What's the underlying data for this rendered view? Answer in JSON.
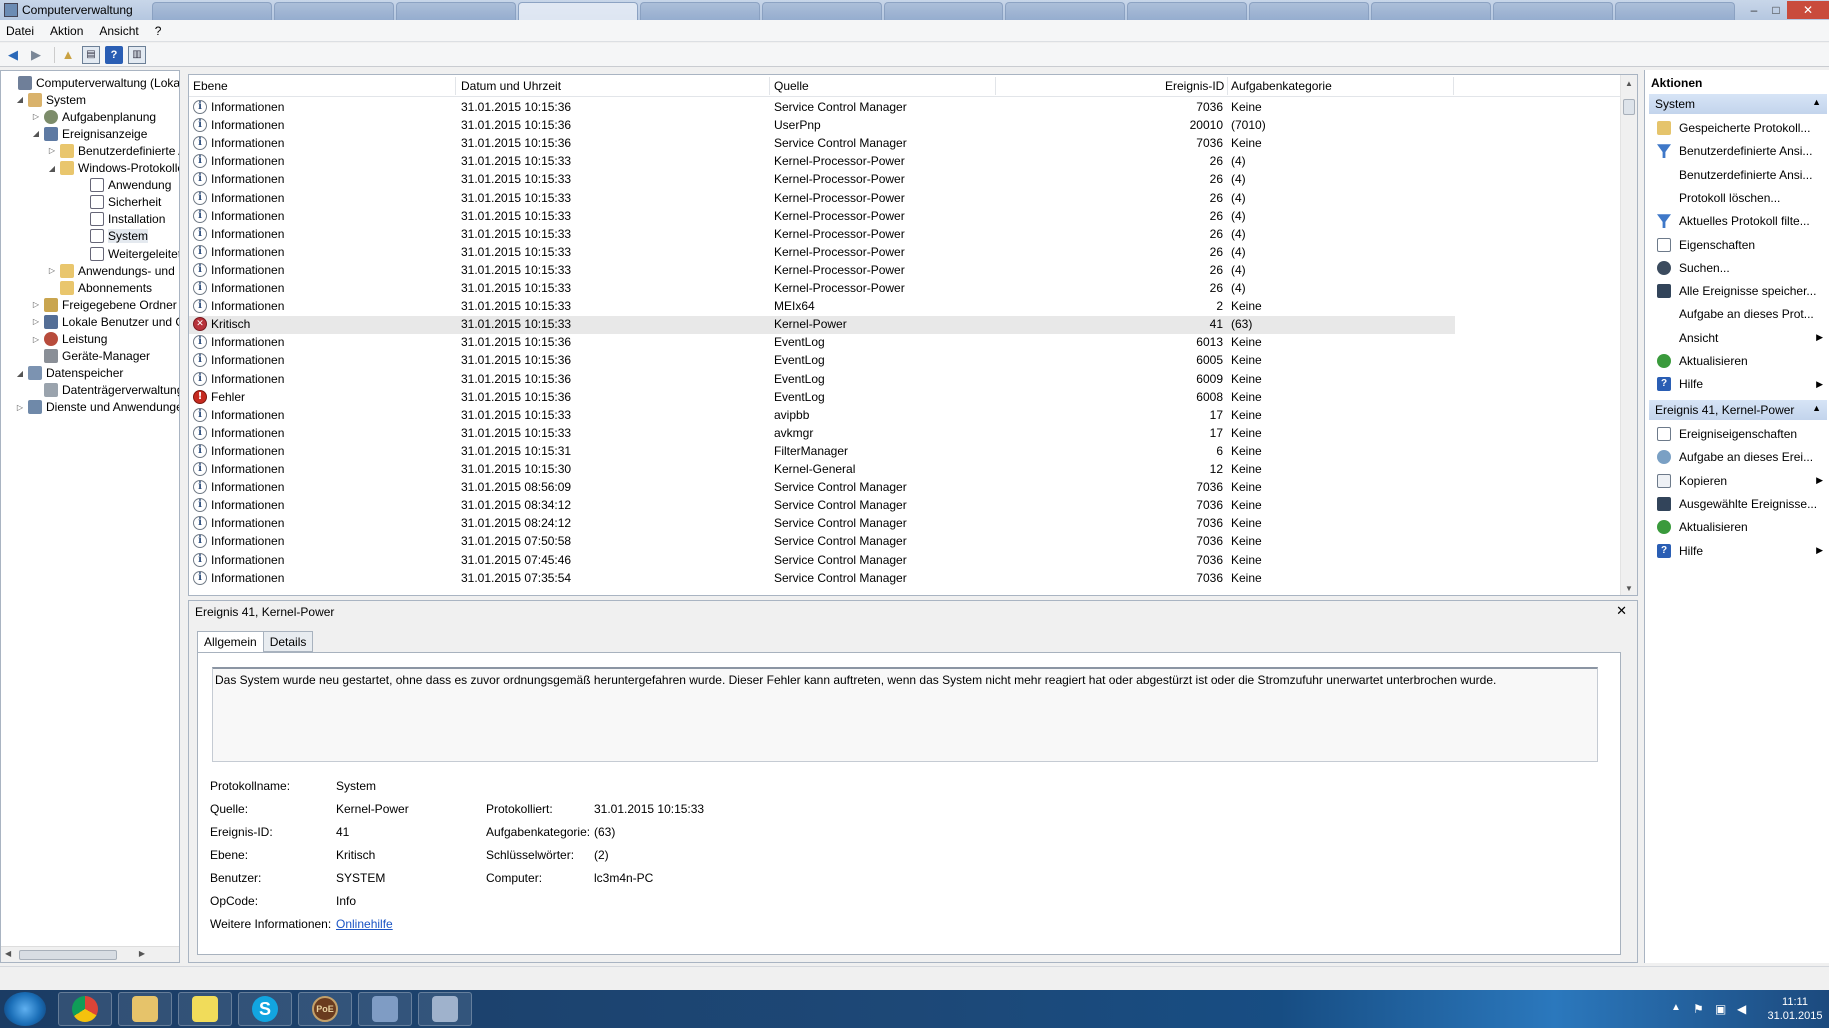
{
  "window": {
    "title": "Computerverwaltung",
    "background_tabs": [
      "",
      "",
      "",
      "",
      "",
      "",
      "",
      "",
      "",
      "",
      "",
      "",
      ""
    ],
    "controls": {
      "minimize": "–",
      "maximize": "□",
      "close": "✕"
    }
  },
  "menu": [
    "Datei",
    "Aktion",
    "Ansicht",
    "?"
  ],
  "tree": [
    {
      "label": "Computerverwaltung (Lokal)",
      "exp": "",
      "icon": "computer-management-icon"
    },
    {
      "label": "System",
      "exp": "◢",
      "icon": "system-tools-icon"
    },
    {
      "label": "Aufgabenplanung",
      "exp": "▷",
      "icon": "task-scheduler-icon"
    },
    {
      "label": "Ereignisanzeige",
      "exp": "◢",
      "icon": "event-viewer-icon"
    },
    {
      "label": "Benutzerdefinierte A",
      "exp": "▷",
      "icon": "folder-icon"
    },
    {
      "label": "Windows-Protokolle",
      "exp": "◢",
      "icon": "folder-icon"
    },
    {
      "label": "Anwendung",
      "exp": "",
      "icon": "log-icon"
    },
    {
      "label": "Sicherheit",
      "exp": "",
      "icon": "log-icon"
    },
    {
      "label": "Installation",
      "exp": "",
      "icon": "log-icon"
    },
    {
      "label": "System",
      "exp": "",
      "icon": "log-icon"
    },
    {
      "label": "Weitergeleitete E",
      "exp": "",
      "icon": "log-icon"
    },
    {
      "label": "Anwendungs- und D",
      "exp": "▷",
      "icon": "folder-icon"
    },
    {
      "label": "Abonnements",
      "exp": "",
      "icon": "subscriptions-icon"
    },
    {
      "label": "Freigegebene Ordner",
      "exp": "▷",
      "icon": "shared-folders-icon"
    },
    {
      "label": "Lokale Benutzer und Gr",
      "exp": "▷",
      "icon": "users-icon"
    },
    {
      "label": "Leistung",
      "exp": "▷",
      "icon": "performance-icon"
    },
    {
      "label": "Geräte-Manager",
      "exp": "",
      "icon": "device-manager-icon"
    },
    {
      "label": "Datenspeicher",
      "exp": "◢",
      "icon": "storage-icon"
    },
    {
      "label": "Datenträgerverwaltung",
      "exp": "",
      "icon": "disk-management-icon"
    },
    {
      "label": "Dienste und Anwendungen",
      "exp": "▷",
      "icon": "services-icon"
    }
  ],
  "events": {
    "columns": [
      "Ebene",
      "Datum und Uhrzeit",
      "Quelle",
      "Ereignis-ID",
      "Aufgabenkategorie"
    ],
    "rows": [
      [
        "Informationen",
        "31.01.2015 10:15:36",
        "Service Control Manager",
        "7036",
        "Keine"
      ],
      [
        "Informationen",
        "31.01.2015 10:15:36",
        "UserPnp",
        "20010",
        "(7010)"
      ],
      [
        "Informationen",
        "31.01.2015 10:15:36",
        "Service Control Manager",
        "7036",
        "Keine"
      ],
      [
        "Informationen",
        "31.01.2015 10:15:33",
        "Kernel-Processor-Power",
        "26",
        "(4)"
      ],
      [
        "Informationen",
        "31.01.2015 10:15:33",
        "Kernel-Processor-Power",
        "26",
        "(4)"
      ],
      [
        "Informationen",
        "31.01.2015 10:15:33",
        "Kernel-Processor-Power",
        "26",
        "(4)"
      ],
      [
        "Informationen",
        "31.01.2015 10:15:33",
        "Kernel-Processor-Power",
        "26",
        "(4)"
      ],
      [
        "Informationen",
        "31.01.2015 10:15:33",
        "Kernel-Processor-Power",
        "26",
        "(4)"
      ],
      [
        "Informationen",
        "31.01.2015 10:15:33",
        "Kernel-Processor-Power",
        "26",
        "(4)"
      ],
      [
        "Informationen",
        "31.01.2015 10:15:33",
        "Kernel-Processor-Power",
        "26",
        "(4)"
      ],
      [
        "Informationen",
        "31.01.2015 10:15:33",
        "Kernel-Processor-Power",
        "26",
        "(4)"
      ],
      [
        "Informationen",
        "31.01.2015 10:15:33",
        "MEIx64",
        "2",
        "Keine"
      ],
      [
        "Kritisch",
        "31.01.2015 10:15:33",
        "Kernel-Power",
        "41",
        "(63)"
      ],
      [
        "Informationen",
        "31.01.2015 10:15:36",
        "EventLog",
        "6013",
        "Keine"
      ],
      [
        "Informationen",
        "31.01.2015 10:15:36",
        "EventLog",
        "6005",
        "Keine"
      ],
      [
        "Informationen",
        "31.01.2015 10:15:36",
        "EventLog",
        "6009",
        "Keine"
      ],
      [
        "Fehler",
        "31.01.2015 10:15:36",
        "EventLog",
        "6008",
        "Keine"
      ],
      [
        "Informationen",
        "31.01.2015 10:15:33",
        "avipbb",
        "17",
        "Keine"
      ],
      [
        "Informationen",
        "31.01.2015 10:15:33",
        "avkmgr",
        "17",
        "Keine"
      ],
      [
        "Informationen",
        "31.01.2015 10:15:31",
        "FilterManager",
        "6",
        "Keine"
      ],
      [
        "Informationen",
        "31.01.2015 10:15:30",
        "Kernel-General",
        "12",
        "Keine"
      ],
      [
        "Informationen",
        "31.01.2015 08:56:09",
        "Service Control Manager",
        "7036",
        "Keine"
      ],
      [
        "Informationen",
        "31.01.2015 08:34:12",
        "Service Control Manager",
        "7036",
        "Keine"
      ],
      [
        "Informationen",
        "31.01.2015 08:24:12",
        "Service Control Manager",
        "7036",
        "Keine"
      ],
      [
        "Informationen",
        "31.01.2015 07:50:58",
        "Service Control Manager",
        "7036",
        "Keine"
      ],
      [
        "Informationen",
        "31.01.2015 07:45:46",
        "Service Control Manager",
        "7036",
        "Keine"
      ],
      [
        "Informationen",
        "31.01.2015 07:35:54",
        "Service Control Manager",
        "7036",
        "Keine"
      ]
    ],
    "selected_row": 12
  },
  "details": {
    "title": "Ereignis 41, Kernel-Power",
    "close": "✕",
    "tabs": [
      "Allgemein",
      "Details"
    ],
    "message": "Das System wurde neu gestartet, ohne dass es zuvor ordnungsgemäß heruntergefahren wurde. Dieser Fehler kann auftreten, wenn das System nicht mehr reagiert hat oder abgestürzt ist oder die Stromzufuhr unerwartet unterbrochen wurde.",
    "fields": {
      "protokollname_label": "Protokollname:",
      "protokollname": "System",
      "quelle_label": "Quelle:",
      "quelle": "Kernel-Power",
      "protokolliert_label": "Protokolliert:",
      "protokolliert": "31.01.2015 10:15:33",
      "ereignisid_label": "Ereignis-ID:",
      "ereignisid": "41",
      "aufgabenkategorie_label": "Aufgabenkategorie:",
      "aufgabenkategorie": "(63)",
      "ebene_label": "Ebene:",
      "ebene": "Kritisch",
      "schluessel_label": "Schlüsselwörter:",
      "schluessel": "(2)",
      "benutzer_label": "Benutzer:",
      "benutzer": "SYSTEM",
      "computer_label": "Computer:",
      "computer": "lc3m4n-PC",
      "opcode_label": "OpCode:",
      "opcode": "Info",
      "weitere_label": "Weitere Informationen:",
      "weitere_link": "Onlinehilfe"
    }
  },
  "actions": {
    "header": "Aktionen",
    "section1": "System",
    "items1": [
      {
        "label": "Gespeicherte Protokoll...",
        "icon": "open-log-icon",
        "sub": ""
      },
      {
        "label": "Benutzerdefinierte Ansi...",
        "icon": "filter-icon",
        "sub": ""
      },
      {
        "label": "Benutzerdefinierte Ansi...",
        "icon": "",
        "sub": ""
      },
      {
        "label": "Protokoll löschen...",
        "icon": "",
        "sub": ""
      },
      {
        "label": "Aktuelles Protokoll filte...",
        "icon": "filter-icon",
        "sub": ""
      },
      {
        "label": "Eigenschaften",
        "icon": "properties-icon",
        "sub": ""
      },
      {
        "label": "Suchen...",
        "icon": "find-icon",
        "sub": ""
      },
      {
        "label": "Alle Ereignisse speicher...",
        "icon": "save-icon",
        "sub": ""
      },
      {
        "label": "Aufgabe an dieses Prot...",
        "icon": "",
        "sub": ""
      },
      {
        "label": "Ansicht",
        "icon": "",
        "sub": "▶"
      },
      {
        "label": "Aktualisieren",
        "icon": "refresh-icon",
        "sub": ""
      },
      {
        "label": "Hilfe",
        "icon": "help-icon",
        "sub": "▶"
      }
    ],
    "section2": "Ereignis 41, Kernel-Power",
    "items2": [
      {
        "label": "Ereigniseigenschaften",
        "icon": "properties-icon",
        "sub": ""
      },
      {
        "label": "Aufgabe an dieses Erei...",
        "icon": "task-icon",
        "sub": ""
      },
      {
        "label": "Kopieren",
        "icon": "copy-icon",
        "sub": "▶"
      },
      {
        "label": "Ausgewählte Ereignisse...",
        "icon": "save-icon",
        "sub": ""
      },
      {
        "label": "Aktualisieren",
        "icon": "refresh-icon",
        "sub": ""
      },
      {
        "label": "Hilfe",
        "icon": "help-icon",
        "sub": "▶"
      }
    ],
    "collapse_glyph": "▲"
  },
  "taskbar": {
    "apps": [
      "chrome-icon",
      "explorer-icon",
      "sticky-notes-icon",
      "skype-icon",
      "poe-icon",
      "network-icon",
      "computer-management-icon"
    ],
    "skype_glyph": "S",
    "poe_glyph": "PoE",
    "clock_time": "11:11",
    "clock_date": "31.01.2015"
  }
}
